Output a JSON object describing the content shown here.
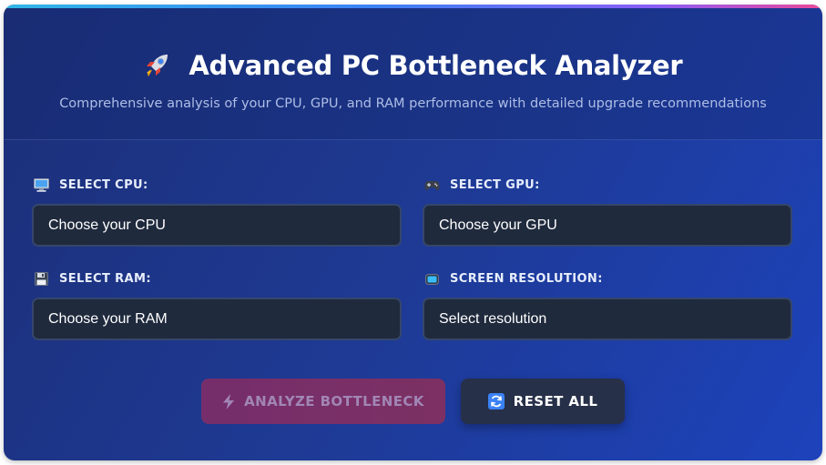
{
  "header": {
    "title": "Advanced PC Bottleneck Analyzer",
    "subtitle": "Comprehensive analysis of your CPU, GPU, and RAM performance with detailed upgrade recommendations"
  },
  "fields": {
    "cpu": {
      "label": "SELECT CPU:",
      "value": "Choose your CPU",
      "icon": "monitor-icon"
    },
    "gpu": {
      "label": "SELECT GPU:",
      "value": "Choose your GPU",
      "icon": "gamepad-icon"
    },
    "ram": {
      "label": "SELECT RAM:",
      "value": "Choose your RAM",
      "icon": "floppy-disk-icon"
    },
    "resolution": {
      "label": "SCREEN RESOLUTION:",
      "value": "Select resolution",
      "icon": "screen-icon"
    }
  },
  "buttons": {
    "analyze": "ANALYZE BOTTLENECK",
    "reset": "RESET ALL"
  },
  "colors": {
    "accent_bar": [
      "#2fb6e6",
      "#3b82f6",
      "#8b5cf6",
      "#ec4899"
    ],
    "analyze_button": "#7a2e6a",
    "reset_button": "#273049",
    "select_bg": "#1f2a3d"
  }
}
